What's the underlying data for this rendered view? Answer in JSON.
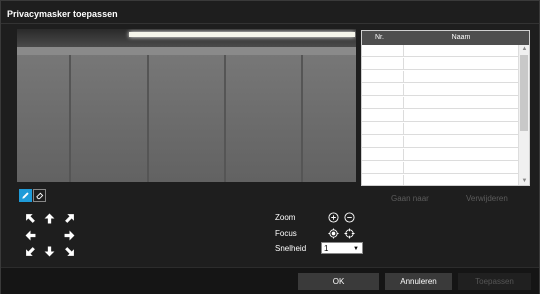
{
  "dialog": {
    "title": "Privacymasker toepassen"
  },
  "mask_table": {
    "columns": [
      "Nr.",
      "Naam"
    ],
    "rows": [],
    "empty_row_count": 11
  },
  "table_actions": {
    "goto_label": "Gaan naar",
    "delete_label": "Verwijderen"
  },
  "tools": [
    {
      "name": "pencil-icon",
      "active": true
    },
    {
      "name": "eraser-icon",
      "active": false
    }
  ],
  "ptz_controls": {
    "zoom_label": "Zoom",
    "focus_label": "Focus",
    "speed_label": "Snelheid",
    "speed_value": "1"
  },
  "footer": {
    "ok_label": "OK",
    "cancel_label": "Annuleren",
    "apply_label": "Toepassen"
  },
  "colors": {
    "accent": "#1f9bd8",
    "dialog_bg": "#1e1e1e",
    "disabled_text": "#5c5c5c"
  }
}
